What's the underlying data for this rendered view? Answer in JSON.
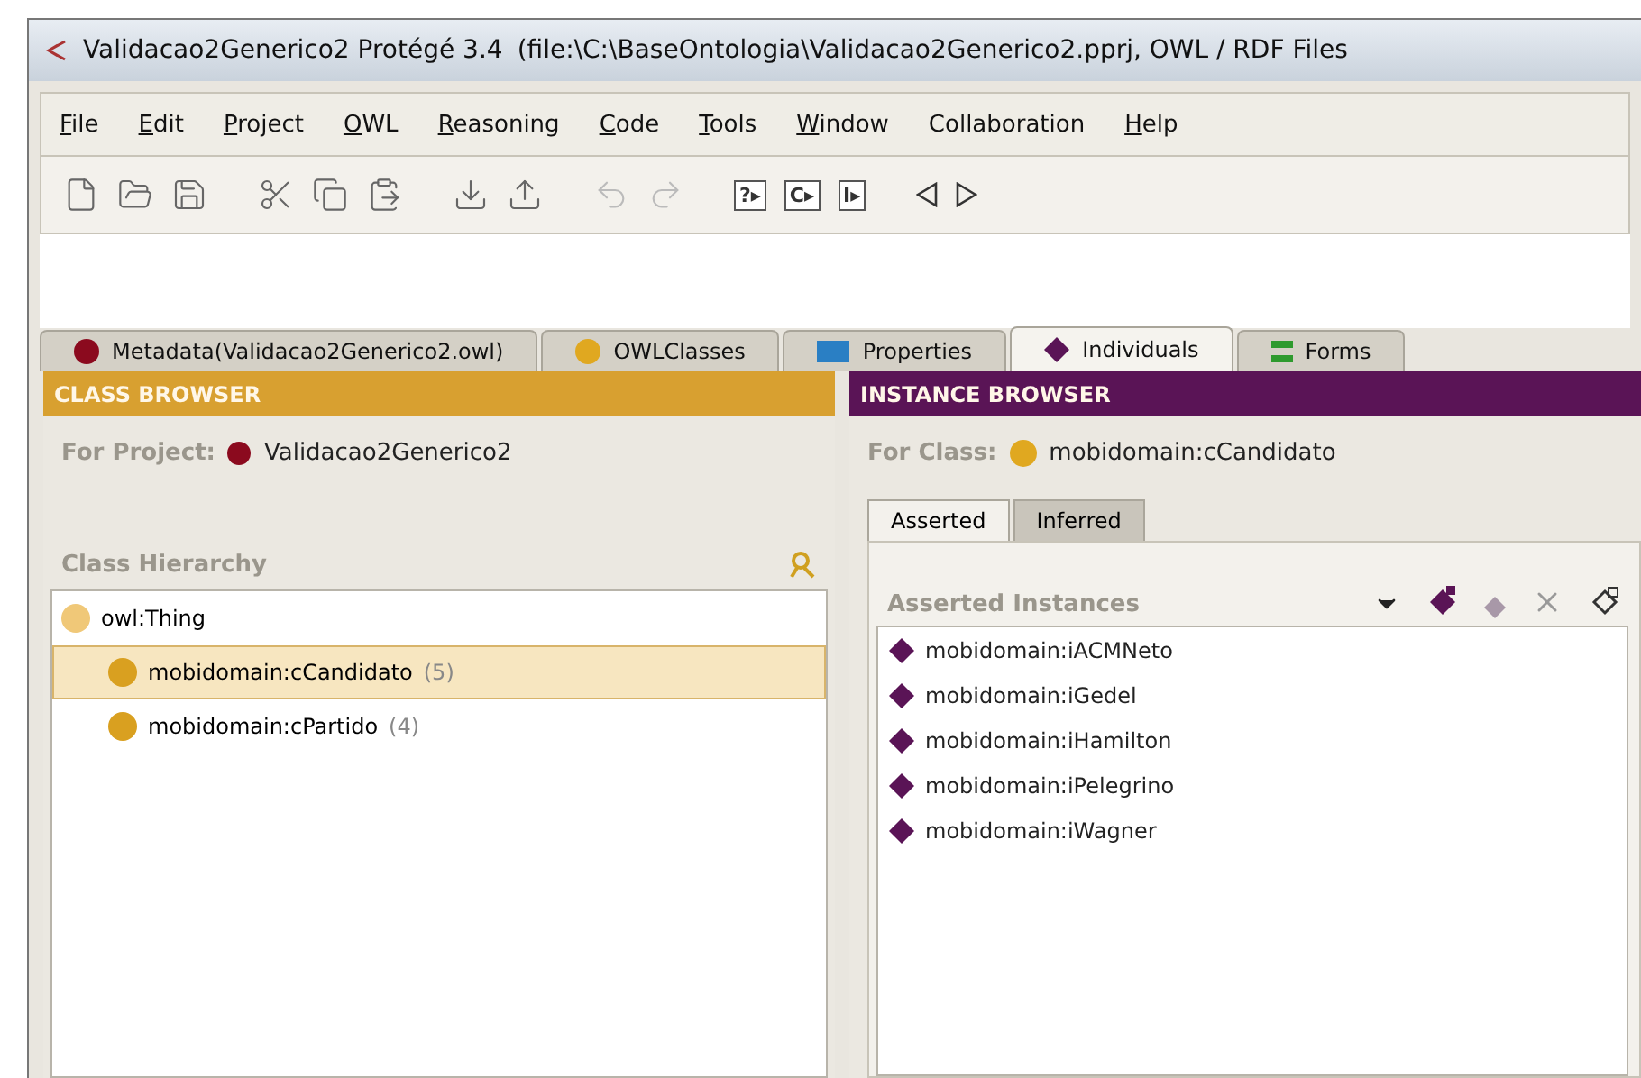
{
  "window": {
    "title": "Validacao2Generico2  Protégé 3.4",
    "path": "(file:\\C:\\BaseOntologia\\Validacao2Generico2.pprj, OWL / RDF Files"
  },
  "menu": [
    {
      "label": "File",
      "underlined_first": true
    },
    {
      "label": "Edit",
      "underlined_first": true
    },
    {
      "label": "Project",
      "underlined_first": true
    },
    {
      "label": "OWL",
      "underlined_first": true
    },
    {
      "label": "Reasoning",
      "underlined_first": true
    },
    {
      "label": "Code",
      "underlined_first": true
    },
    {
      "label": "Tools",
      "underlined_first": true
    },
    {
      "label": "Window",
      "underlined_first": true
    },
    {
      "label": "Collaboration",
      "underlined_first": false
    },
    {
      "label": "Help",
      "underlined_first": true
    }
  ],
  "toolbar": [
    {
      "kind": "new"
    },
    {
      "kind": "open"
    },
    {
      "kind": "save"
    },
    {
      "kind": "gap"
    },
    {
      "kind": "cut"
    },
    {
      "kind": "copy"
    },
    {
      "kind": "paste"
    },
    {
      "kind": "gap"
    },
    {
      "kind": "import"
    },
    {
      "kind": "export"
    },
    {
      "kind": "gap"
    },
    {
      "kind": "undo"
    },
    {
      "kind": "redo"
    },
    {
      "kind": "gap"
    },
    {
      "kind": "boxed",
      "label": "?▸"
    },
    {
      "kind": "boxed",
      "label": "C▸"
    },
    {
      "kind": "boxed",
      "label": "I▸"
    },
    {
      "kind": "gap"
    },
    {
      "kind": "back"
    },
    {
      "kind": "forward"
    }
  ],
  "tabs": [
    {
      "label": "Metadata(Validacao2Generico2.owl)",
      "kind": "dot",
      "color": "#8b0a1e",
      "selected": false
    },
    {
      "label": "OWLClasses",
      "kind": "dot",
      "color": "#e0a820",
      "selected": false
    },
    {
      "label": "Properties",
      "kind": "rect",
      "color": "#2a7fc4",
      "selected": false
    },
    {
      "label": "Individuals",
      "kind": "diamond",
      "color": "#5a1456",
      "selected": true
    },
    {
      "label": "Forms",
      "kind": "form",
      "color": "#2e9a2e",
      "selected": false
    }
  ],
  "class_browser": {
    "header": "CLASS BROWSER",
    "project_label": "For Project:",
    "project": "Validacao2Generico2",
    "hierarchy_label": "Class Hierarchy",
    "tree": [
      {
        "label": "owl:Thing",
        "selected": false,
        "children": [
          {
            "label": "mobidomain:cCandidato",
            "count": "(5)",
            "selected": true
          },
          {
            "label": "mobidomain:cPartido",
            "count": "(4)",
            "selected": false
          }
        ]
      }
    ]
  },
  "instance_browser": {
    "header": "INSTANCE BROWSER",
    "class_label": "For Class:",
    "class": "mobidomain:cCandidato",
    "tabs": [
      {
        "label": "Asserted",
        "selected": true
      },
      {
        "label": "Inferred",
        "selected": false
      }
    ],
    "list_label": "Asserted Instances",
    "instances": [
      "mobidomain:iACMNeto",
      "mobidomain:iGedel",
      "mobidomain:iHamilton",
      "mobidomain:iPelegrino",
      "mobidomain:iWagner"
    ]
  }
}
